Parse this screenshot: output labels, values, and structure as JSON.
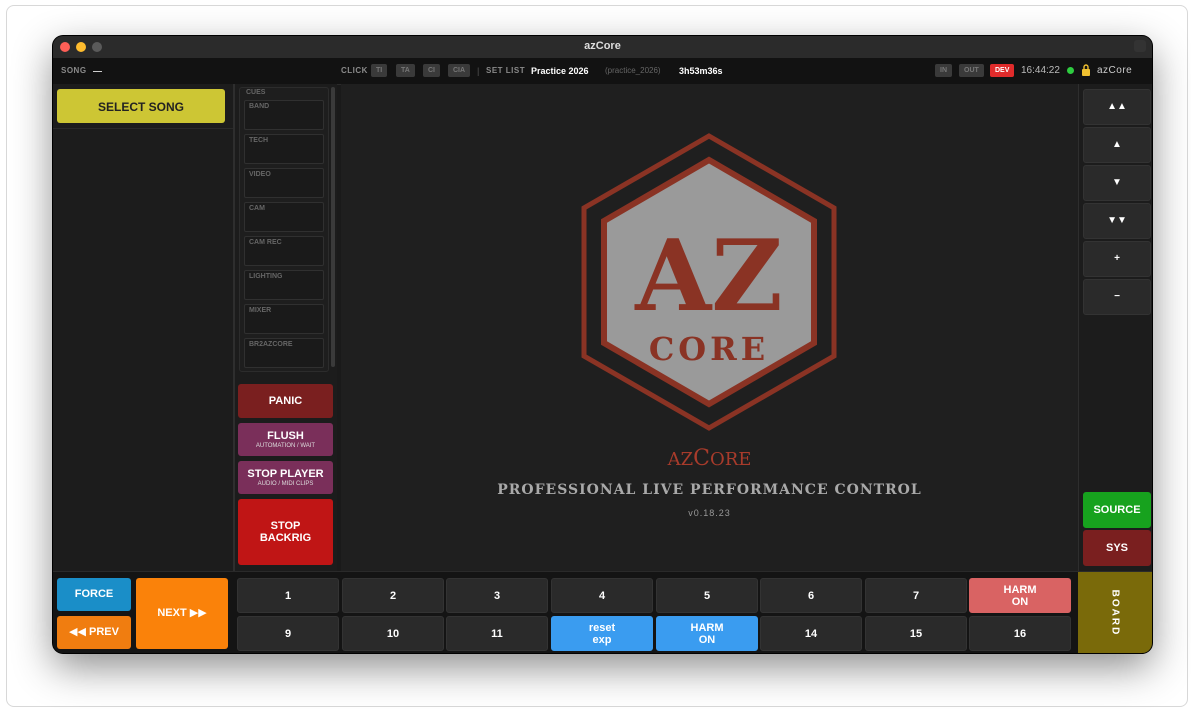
{
  "window": {
    "title": "azCore"
  },
  "statusbar": {
    "song_label": "SONG",
    "song_value": "—",
    "click_label": "CLICK",
    "click_pills": [
      "TI",
      "TA",
      "CI",
      "CIA"
    ],
    "setlist_label": "SET LIST",
    "setlist_name": "Practice 2026",
    "setlist_id": "(practice_2026)",
    "duration": "3h53m36s",
    "in_label": "IN",
    "out_label": "OUT",
    "dev_label": "DEV",
    "clock": "16:44:22",
    "brand": "azCore"
  },
  "left": {
    "select_song": "SELECT SONG"
  },
  "cues": {
    "title": "CUES",
    "items": [
      "BAND",
      "TECH",
      "VIDEO",
      "CAM",
      "CAM REC",
      "LIGHTING",
      "MIXER",
      "BR2AZCORE"
    ]
  },
  "actions": {
    "panic": "PANIC",
    "flush": "FLUSH",
    "flush_sub": "AUTOMATION / WAIT",
    "stop_player": "STOP PLAYER",
    "stop_player_sub": "AUDIO / MIDI CLIPS",
    "stop_backrig_1": "STOP",
    "stop_backrig_2": "BACKRIG"
  },
  "logo": {
    "letters": "AZ",
    "core": "CORE",
    "app_name_prefix": "AZ",
    "app_name_core_big": "C",
    "app_name_core_rest": "ORE",
    "tagline": "PROFESSIONAL LIVE PERFORMANCE CONTROL",
    "version": "v0.18.23"
  },
  "right": {
    "buttons": [
      "▲▲",
      "▲",
      "▼",
      "▼▼",
      "+",
      "−"
    ],
    "source": "SOURCE",
    "sys": "SYS"
  },
  "bottom": {
    "force": "FORCE",
    "prev": "◀◀ PREV",
    "next": "NEXT ▶▶",
    "row1": [
      "1",
      "2",
      "3",
      "4",
      "5",
      "6",
      "7",
      "HARM\nON"
    ],
    "row2": [
      "9",
      "10",
      "11",
      "reset\nexp",
      "HARM\nON",
      "14",
      "15",
      "16"
    ],
    "board": "BOARD"
  },
  "colors": {
    "select_song": "#cdc634",
    "panic": "#7a1f1f",
    "flush": "#7a2f5a",
    "stop_backrig": "#c01515",
    "source": "#17a21e",
    "sys": "#7a1f1f",
    "force": "#1a8ec8",
    "next": "#fa820a",
    "pad_blue": "#3a9cf0",
    "pad_pink": "#d96363",
    "board": "#7a6a0a",
    "logo_red": "#a83b2b",
    "dev": "#e02b2b"
  }
}
